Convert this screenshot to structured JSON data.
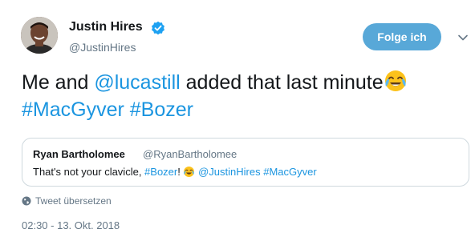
{
  "author": {
    "name": "Justin Hires",
    "handle": "@JustinHires",
    "verified": true
  },
  "follow_button": {
    "label": "Folge ich"
  },
  "tweet": {
    "text_parts": [
      "Me and ",
      "@lucastill",
      " added that last minute",
      "#MacGyver",
      " ",
      "#Bozer"
    ],
    "emoji": "face-with-tears-of-joy"
  },
  "quoted_tweet": {
    "name": "Ryan Bartholomee",
    "handle": "@RyanBartholomee",
    "text_parts": [
      "That's not your clavicle, ",
      "#Bozer",
      "! ",
      " ",
      "@JustinHires",
      " ",
      "#MacGyver"
    ]
  },
  "translate_label": "Tweet übersetzen",
  "timestamp": "02:30 - 13. Okt. 2018",
  "colors": {
    "link": "#1b95e0",
    "follow_bg": "#58a8d8",
    "muted": "#657786"
  }
}
